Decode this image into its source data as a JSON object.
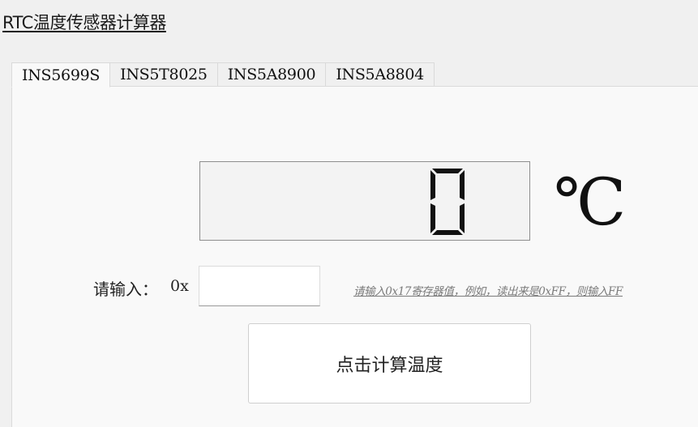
{
  "app": {
    "title": "RTC温度传感器计算器"
  },
  "tabs": [
    {
      "label": "INS5699S",
      "active": true
    },
    {
      "label": "INS5T8025",
      "active": false
    },
    {
      "label": "INS5A8900",
      "active": false
    },
    {
      "label": "INS5A8804",
      "active": false
    }
  ],
  "display": {
    "value": "0",
    "unit": "℃"
  },
  "input": {
    "label": "请输入：",
    "prefix": "0x",
    "value": "",
    "placeholder": "",
    "hint": "请输入0x17寄存器值，例如，读出来是0xFF，则输入FF"
  },
  "actions": {
    "calculate_label": "点击计算温度"
  }
}
